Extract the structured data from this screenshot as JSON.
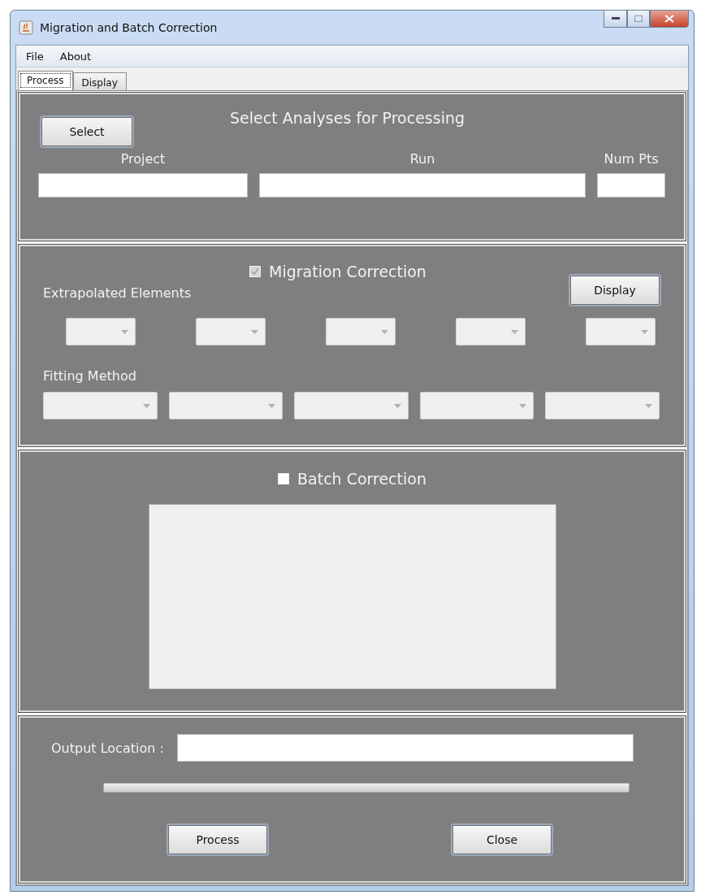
{
  "window": {
    "title": "Migration and Batch Correction"
  },
  "menu": [
    "File",
    "About"
  ],
  "tabs": [
    {
      "label": "Process",
      "selected": true
    },
    {
      "label": "Display",
      "selected": false
    }
  ],
  "selection": {
    "button": "Select",
    "heading": "Select Analyses for Processing",
    "fields": [
      {
        "label": "Project"
      },
      {
        "label": "Run"
      },
      {
        "label": "Num Pts"
      }
    ]
  },
  "migration": {
    "label": "Migration Correction",
    "checked": true,
    "disabled": true,
    "display_button": "Display",
    "elements_label": "Extrapolated Elements",
    "elements": [
      {
        "disabled": true
      },
      {
        "disabled": true
      },
      {
        "disabled": true
      },
      {
        "disabled": true
      },
      {
        "disabled": true
      }
    ],
    "fitting_label": "Fitting Method",
    "fitting": [
      {
        "disabled": true
      },
      {
        "disabled": true
      },
      {
        "disabled": true
      },
      {
        "disabled": true
      },
      {
        "disabled": true
      }
    ]
  },
  "batch": {
    "label": "Batch Correction",
    "checked": false,
    "disabled": false
  },
  "output": {
    "label": "Output Location :",
    "progress": {
      "level": 0
    }
  },
  "buttons": [
    "Process",
    "Close"
  ]
}
